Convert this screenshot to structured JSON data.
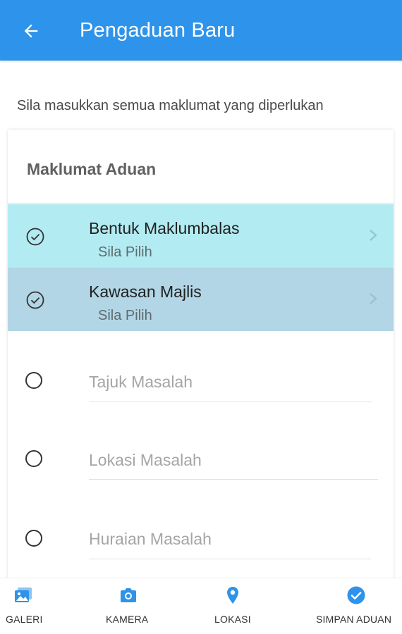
{
  "appbar": {
    "title": "Pengaduan Baru",
    "back_icon": "arrow-back-icon",
    "color": "#2e93ea"
  },
  "intro": "Sila masukkan semua maklumat yang diperlukan",
  "card": {
    "header": "Maklumat Aduan",
    "steps": [
      {
        "label": "Bentuk Maklumbalas",
        "value": "Sila Pilih",
        "status": "completed",
        "icon": "check-circle-icon",
        "bg": "#b2ebf2"
      },
      {
        "label": "Kawasan Majlis",
        "value": "Sila Pilih",
        "status": "completed",
        "icon": "check-circle-icon",
        "bg": "#b2d6e6"
      }
    ],
    "fields": [
      {
        "placeholder": "Tajuk Masalah",
        "icon": "radio-empty-icon"
      },
      {
        "placeholder": "Lokasi Masalah",
        "icon": "radio-empty-icon"
      },
      {
        "placeholder": "Huraian Masalah",
        "icon": "radio-empty-icon"
      }
    ]
  },
  "bottom_nav": [
    {
      "label": "GALERI",
      "icon": "gallery-icon"
    },
    {
      "label": "KAMERA",
      "icon": "camera-icon"
    },
    {
      "label": "LOKASI",
      "icon": "location-pin-icon"
    },
    {
      "label": "SIMPAN ADUAN",
      "icon": "check-circle-filled-icon"
    }
  ],
  "accent_color": "#2e93ea"
}
